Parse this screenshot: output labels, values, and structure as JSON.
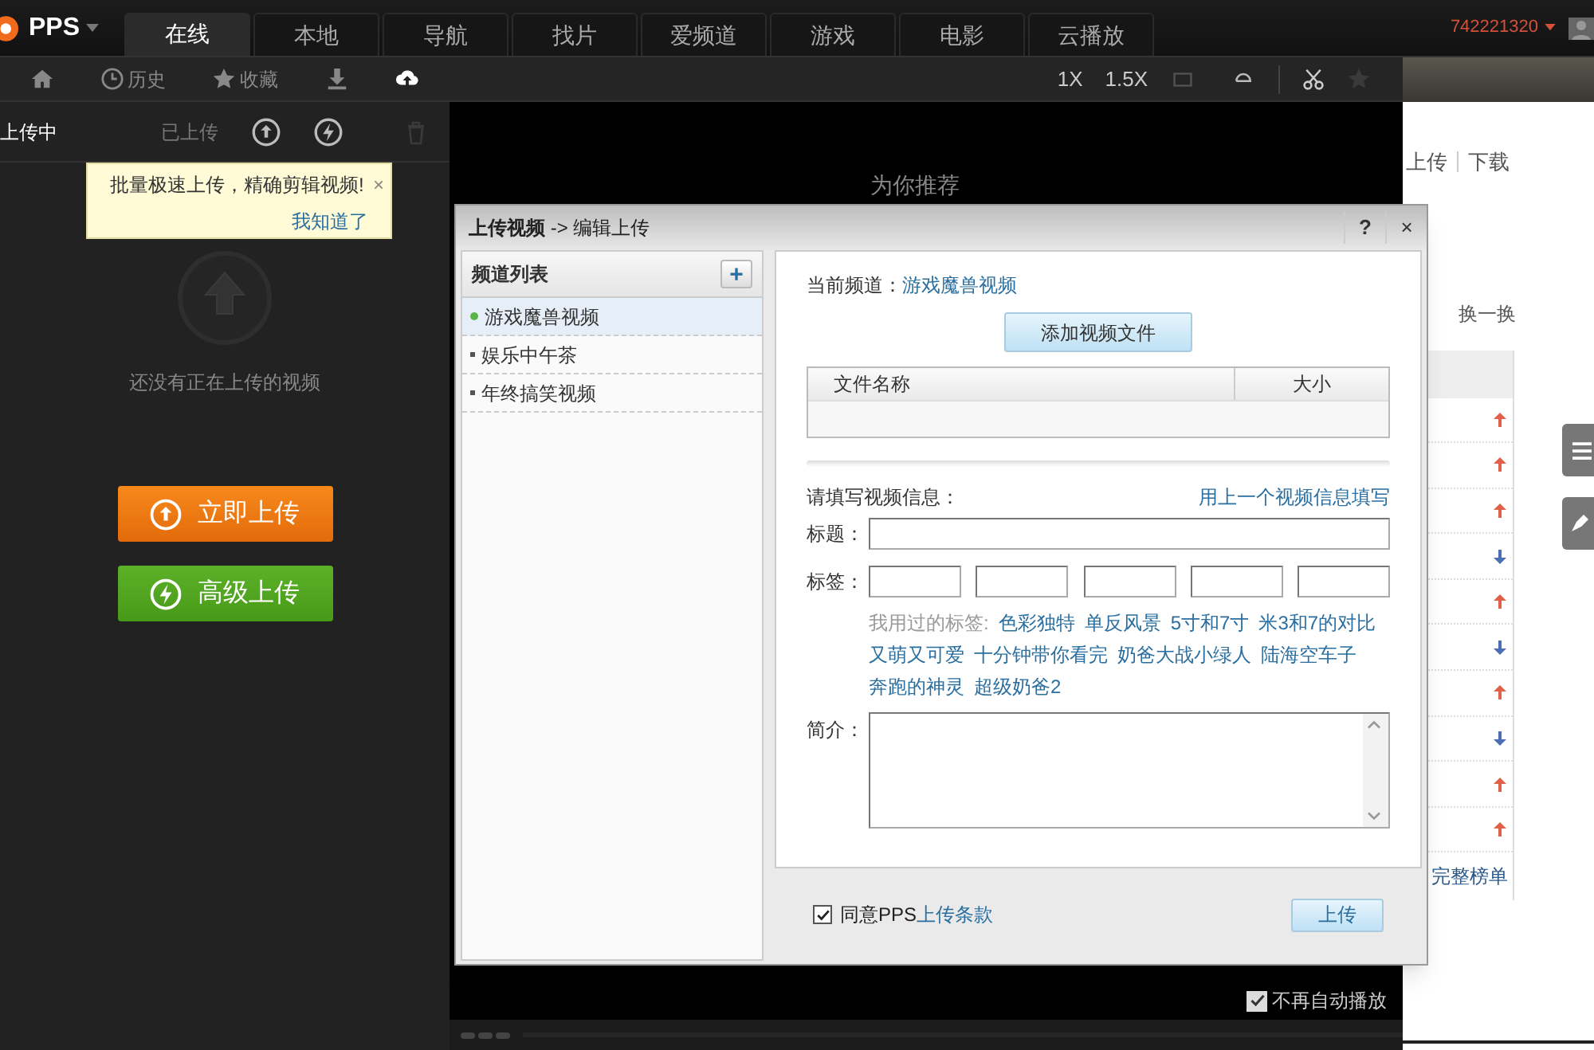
{
  "app": {
    "logo": "PPS",
    "user_id": "742221320"
  },
  "main_tabs": [
    {
      "label": "在线",
      "selected": true
    },
    {
      "label": "本地",
      "selected": false
    },
    {
      "label": "导航",
      "selected": false
    },
    {
      "label": "找片",
      "selected": false
    },
    {
      "label": "爱频道",
      "selected": false
    },
    {
      "label": "游戏",
      "selected": false
    },
    {
      "label": "电影",
      "selected": false
    },
    {
      "label": "云播放",
      "selected": false
    }
  ],
  "sidebar_toolbar": [
    {
      "kind": "home",
      "selected": false
    },
    {
      "kind": "history",
      "label": "历史",
      "selected": false
    },
    {
      "kind": "favorite",
      "label": "收藏",
      "selected": false
    },
    {
      "kind": "download",
      "selected": false
    },
    {
      "kind": "upload",
      "selected": true
    }
  ],
  "player_toolbar": {
    "speeds": [
      "1X",
      "1.5X"
    ],
    "favorite_disabled": true
  },
  "upload_panel": {
    "tabs": [
      {
        "label": "上传中",
        "selected": true
      },
      {
        "label": "已上传",
        "selected": false
      }
    ],
    "trash_disabled": true,
    "tip": {
      "text": "批量极速上传，精确剪辑视频!",
      "close": "×",
      "link": "我知道了"
    },
    "empty_text": "还没有正在上传的视频",
    "buttons": [
      {
        "kind": "upload",
        "label": "立即上传"
      },
      {
        "kind": "advanced",
        "label": "高级上传"
      }
    ]
  },
  "player": {
    "recommend_title": "为你推荐",
    "autoplay_off": {
      "label": "不再自动播放",
      "checked": true
    }
  },
  "web_page": {
    "links": [
      "上传",
      "下载"
    ],
    "refresh": "换一换",
    "full_list": "完整榜单",
    "ranking": [
      {
        "kind": "up"
      },
      {
        "kind": "up"
      },
      {
        "kind": "up"
      },
      {
        "kind": "down"
      },
      {
        "kind": "up"
      },
      {
        "kind": "down"
      },
      {
        "kind": "up"
      },
      {
        "kind": "down"
      },
      {
        "kind": "up"
      },
      {
        "kind": "up"
      }
    ]
  },
  "dialog": {
    "title": "**上传视频** -> 编辑上传",
    "help": "?",
    "close": "×",
    "channel_list": {
      "title": "频道列表",
      "add": "+",
      "items": [
        {
          "label": "游戏魔兽视频",
          "selected": true
        },
        {
          "label": "娱乐中午茶",
          "selected": false
        },
        {
          "label": "年终搞笑视频",
          "selected": false
        }
      ]
    },
    "current_channel_label": "当前频道：",
    "current_channel": "游戏魔兽视频",
    "add_file_button": "添加视频文件",
    "file_table": {
      "columns": [
        "文件名称",
        "大小"
      ]
    },
    "info_label": "请填写视频信息：",
    "reuse_link": "用上一个视频信息填写",
    "title_label": "标题：",
    "tags_label": "标签：",
    "used_tags_label": "我用过的标签:",
    "used_tags": [
      "色彩独特",
      "单反风景",
      "5寸和7寸",
      "米3和7的对比",
      "又萌又可爱",
      "十分钟带你看完",
      "奶爸大战小绿人",
      "陆海空车子",
      "奔跑的神灵",
      "超级奶爸2"
    ],
    "intro_label": "简介：",
    "agree": {
      "checked": true,
      "text": "同意PPS",
      "link": "上传条款"
    },
    "submit": "上传"
  }
}
